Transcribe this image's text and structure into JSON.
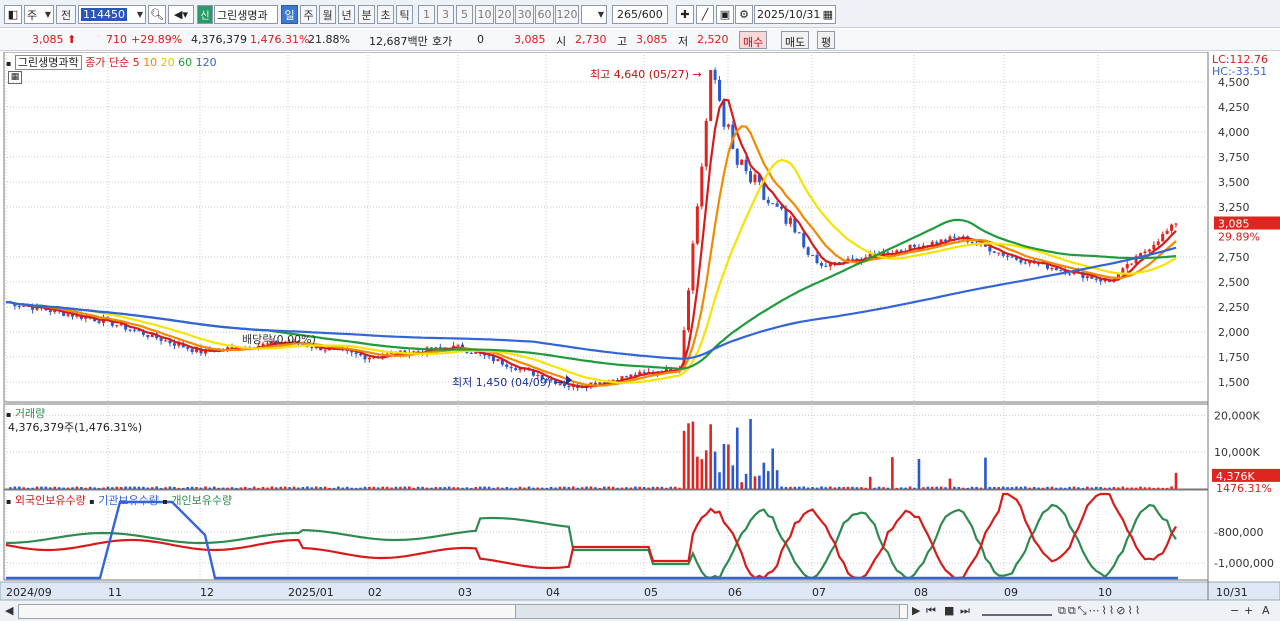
{
  "toolbar": {
    "market_type": "주",
    "market_prev": "전",
    "code": "114450",
    "stock_badge": "신",
    "stock_name": "그린생명과",
    "periods": [
      "일",
      "주",
      "월",
      "년",
      "분",
      "초",
      "틱"
    ],
    "active_period": "일",
    "intervals": [
      "1",
      "3",
      "5",
      "10",
      "20",
      "30",
      "60",
      "120"
    ],
    "count_value": "265",
    "count_total": "/600",
    "date": "2025/10/31"
  },
  "quote": {
    "price": "3,085",
    "change": "710",
    "change_rate": "+29.89%",
    "volume": "4,376,379",
    "volume_rate": "1,476.31%",
    "turnover": "21.88%",
    "amount": "12,687백만",
    "hoga_label": "호가",
    "hoga_value": "0",
    "hoga_price": "3,085",
    "open_label": "시",
    "open": "2,730",
    "high_label": "고",
    "high": "3,085",
    "low_label": "저",
    "low": "2,520",
    "buy_label": "매수",
    "sell_label": "매도",
    "avg_label": "평"
  },
  "legend": {
    "stock_name": "그린생명과학",
    "ma_label": "종가 단순",
    "ma_periods": [
      "5",
      "10",
      "20",
      "60",
      "120"
    ],
    "ma_colors": [
      "#d71b1b",
      "#f08a00",
      "#f5e400",
      "#1f9a3c",
      "#3563d8"
    ],
    "volume_title": "거래량",
    "volume_value": "4,376,379주(1,476.31%)",
    "holder_titles": [
      "외국인보유수량",
      "기관보유수량",
      "개인보유수량"
    ],
    "holder_colors": [
      "#d71b1b",
      "#3563d8",
      "#2e8a50"
    ]
  },
  "annotations": {
    "high": "최고 4,640 (05/27)",
    "low": "최저 1,450 (04/09)",
    "dividend": "배당락(0.00%)",
    "lc": "LC:112.76",
    "hc": "HC:-33.51"
  },
  "axes": {
    "price_ticks": [
      "4,500",
      "4,250",
      "4,000",
      "3,750",
      "3,500",
      "3,250",
      "2,750",
      "2,500",
      "2,250",
      "2,000",
      "1,750",
      "1,500"
    ],
    "current_price": "3,085",
    "current_rate": "29.89%",
    "volume_ticks": [
      "20,000K",
      "10,000K"
    ],
    "current_volume": "4,376K",
    "current_volume_rate": "1476.31%",
    "holder_ticks": [
      "-800,000",
      "-1,000,000"
    ],
    "x_labels": [
      "2024/09",
      "11",
      "12",
      "2025/01",
      "02",
      "03",
      "04",
      "05",
      "06",
      "07",
      "08",
      "09",
      "10"
    ],
    "x_end": "10/31"
  },
  "chart_data": {
    "type": "candlestick",
    "price_ylim": [
      1300,
      4800
    ],
    "dates_start": "2024/09",
    "dates_end": "2025/10/31",
    "key_points": [
      {
        "label": "2024/09",
        "close": 2300
      },
      {
        "label": "11",
        "close": 2100
      },
      {
        "label": "12",
        "close": 1800
      },
      {
        "label": "2025/01",
        "close": 1900
      },
      {
        "label": "02",
        "close": 1750
      },
      {
        "label": "03",
        "close": 1850
      },
      {
        "label": "04/09",
        "close": 1450
      },
      {
        "label": "05",
        "close": 1650
      },
      {
        "label": "05/27",
        "close": 4640
      },
      {
        "label": "06",
        "close": 3700
      },
      {
        "label": "07",
        "close": 2650
      },
      {
        "label": "08",
        "close": 2950
      },
      {
        "label": "09",
        "close": 2750
      },
      {
        "label": "10",
        "close": 2500
      },
      {
        "label": "10/31",
        "close": 3085
      }
    ],
    "volume_ylim": [
      0,
      22000
    ]
  }
}
